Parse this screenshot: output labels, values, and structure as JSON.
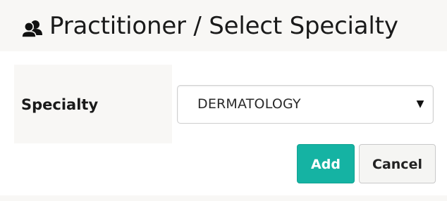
{
  "header": {
    "title": "Practitioner / Select Specialty",
    "icon": "users-icon"
  },
  "form": {
    "specialty_label": "Specialty",
    "specialty_value": "DERMATOLOGY",
    "dropdown_icon": "triangle-down-icon"
  },
  "actions": {
    "add_label": "Add",
    "cancel_label": "Cancel"
  },
  "colors": {
    "header_bg": "#f8f7f5",
    "primary_button": "#15b3a3",
    "secondary_button": "#f5f5f3",
    "text": "#1a1a1a"
  }
}
